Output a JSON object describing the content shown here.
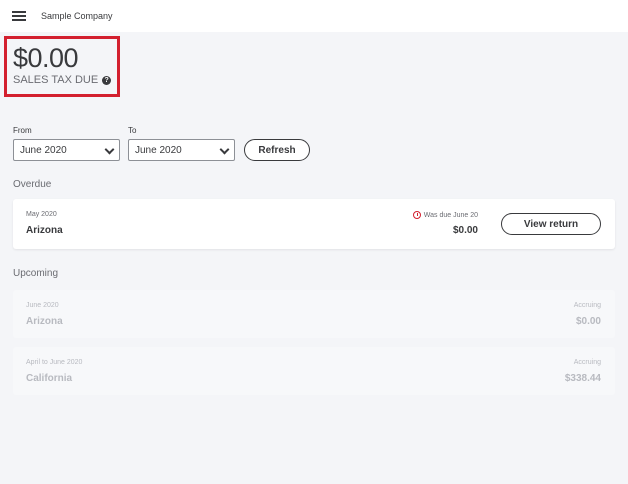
{
  "header": {
    "company_name": "Sample Company"
  },
  "summary": {
    "amount": "$0.00",
    "label": "SALES TAX DUE",
    "highlight_color": "#d3202f"
  },
  "filters": {
    "from_label": "From",
    "from_value": "June 2020",
    "to_label": "To",
    "to_value": "June 2020",
    "refresh_label": "Refresh"
  },
  "overdue": {
    "title": "Overdue",
    "items": [
      {
        "period": "May 2020",
        "state": "Arizona",
        "status": "Was due June 20",
        "amount": "$0.00",
        "action": "View return"
      }
    ]
  },
  "upcoming": {
    "title": "Upcoming",
    "items": [
      {
        "period": "June 2020",
        "state": "Arizona",
        "status": "Accruing",
        "amount": "$0.00"
      },
      {
        "period": "April to June 2020",
        "state": "California",
        "status": "Accruing",
        "amount": "$338.44"
      }
    ]
  }
}
